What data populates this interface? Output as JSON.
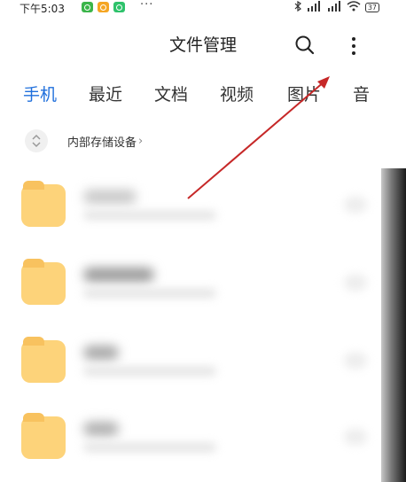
{
  "status_bar": {
    "time": "下午5:03",
    "dots": "···",
    "battery": "37",
    "notification_colors": [
      "#3bb54a",
      "#f5a623",
      "#2ec26b"
    ]
  },
  "header": {
    "title": "文件管理",
    "search_icon": "search-icon",
    "more_icon": "more-vertical-icon"
  },
  "tabs": [
    {
      "label": "手机",
      "active": true
    },
    {
      "label": "最近",
      "active": false
    },
    {
      "label": "文档",
      "active": false
    },
    {
      "label": "视频",
      "active": false
    },
    {
      "label": "图片",
      "active": false
    },
    {
      "label": "音",
      "active": false
    }
  ],
  "path": {
    "label": "内部存储设备",
    "chevron": "›"
  },
  "colors": {
    "accent": "#1f6fdc",
    "folder": "#fdd37a",
    "annotation_arrow": "#c62828"
  }
}
